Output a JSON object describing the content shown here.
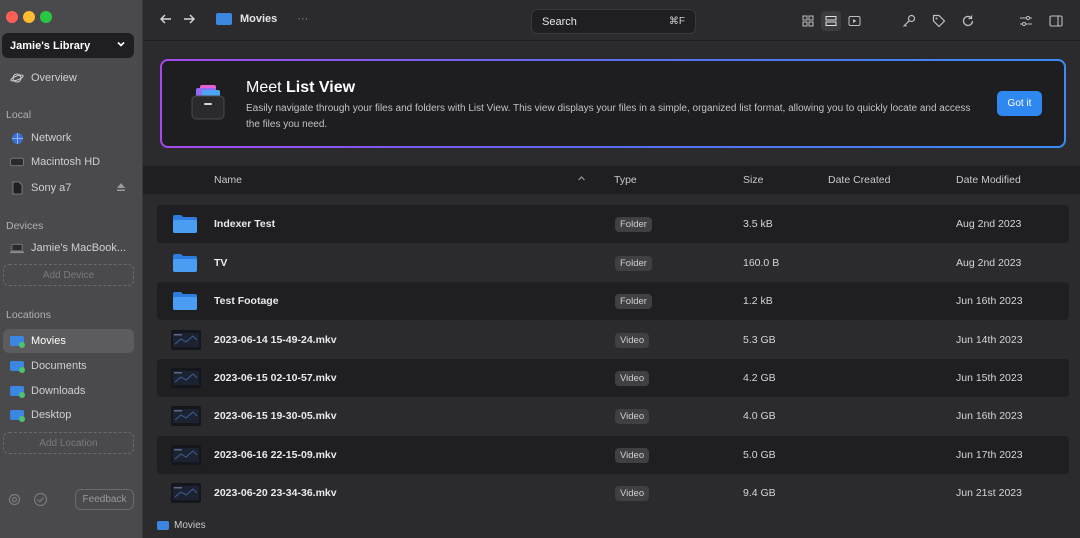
{
  "window": {
    "traffic_colors": [
      "#fe5f57",
      "#febc2e",
      "#28c840"
    ]
  },
  "sidebar": {
    "library_name": "Jamie's Library",
    "overview": "Overview",
    "sections": {
      "local": "Local",
      "devices": "Devices",
      "locations": "Locations"
    },
    "local_items": [
      {
        "label": "Network",
        "icon": "globe-icon"
      },
      {
        "label": "Macintosh HD",
        "icon": "drive-icon"
      },
      {
        "label": "Sony a7",
        "icon": "sdcard-icon"
      }
    ],
    "device_items": [
      {
        "label": "Jamie's MacBook...",
        "icon": "laptop-icon"
      }
    ],
    "add_device": "Add Device",
    "location_items": [
      {
        "label": "Movies",
        "icon": "folder-icon",
        "active": true
      },
      {
        "label": "Documents",
        "icon": "folder-icon"
      },
      {
        "label": "Downloads",
        "icon": "folder-icon"
      },
      {
        "label": "Desktop",
        "icon": "folder-icon"
      }
    ],
    "add_location": "Add Location",
    "feedback": "Feedback"
  },
  "topbar": {
    "breadcrumb": "Movies",
    "more": "···",
    "search_placeholder": "Search",
    "search_shortcut": "⌘F"
  },
  "banner": {
    "title_prefix": "Meet ",
    "title_bold": "List View",
    "description": "Easily navigate through your files and folders with List View. This view displays your files in a simple, organized list format, allowing you to quickly locate and access the files you need.",
    "button": "Got it",
    "accent": "#2f88f0"
  },
  "table": {
    "columns": {
      "name": "Name",
      "type": "Type",
      "size": "Size",
      "created": "Date Created",
      "modified": "Date Modified"
    },
    "rows": [
      {
        "name": "Indexer Test",
        "type": "Folder",
        "size": "3.5 kB",
        "modified": "Aug 2nd 2023",
        "kind": "folder"
      },
      {
        "name": "TV",
        "type": "Folder",
        "size": "160.0 B",
        "modified": "Aug 2nd 2023",
        "kind": "folder"
      },
      {
        "name": "Test Footage",
        "type": "Folder",
        "size": "1.2 kB",
        "modified": "Jun 16th 2023",
        "kind": "folder"
      },
      {
        "name": "2023-06-14 15-49-24.mkv",
        "type": "Video",
        "size": "5.3 GB",
        "modified": "Jun 14th 2023",
        "kind": "video"
      },
      {
        "name": "2023-06-15 02-10-57.mkv",
        "type": "Video",
        "size": "4.2 GB",
        "modified": "Jun 15th 2023",
        "kind": "video"
      },
      {
        "name": "2023-06-15 19-30-05.mkv",
        "type": "Video",
        "size": "4.0 GB",
        "modified": "Jun 16th 2023",
        "kind": "video"
      },
      {
        "name": "2023-06-16 22-15-09.mkv",
        "type": "Video",
        "size": "5.0 GB",
        "modified": "Jun 17th 2023",
        "kind": "video"
      },
      {
        "name": "2023-06-20 23-34-36.mkv",
        "type": "Video",
        "size": "9.4 GB",
        "modified": "Jun 21st 2023",
        "kind": "video"
      }
    ]
  },
  "statusbar": {
    "path": "Movies"
  }
}
